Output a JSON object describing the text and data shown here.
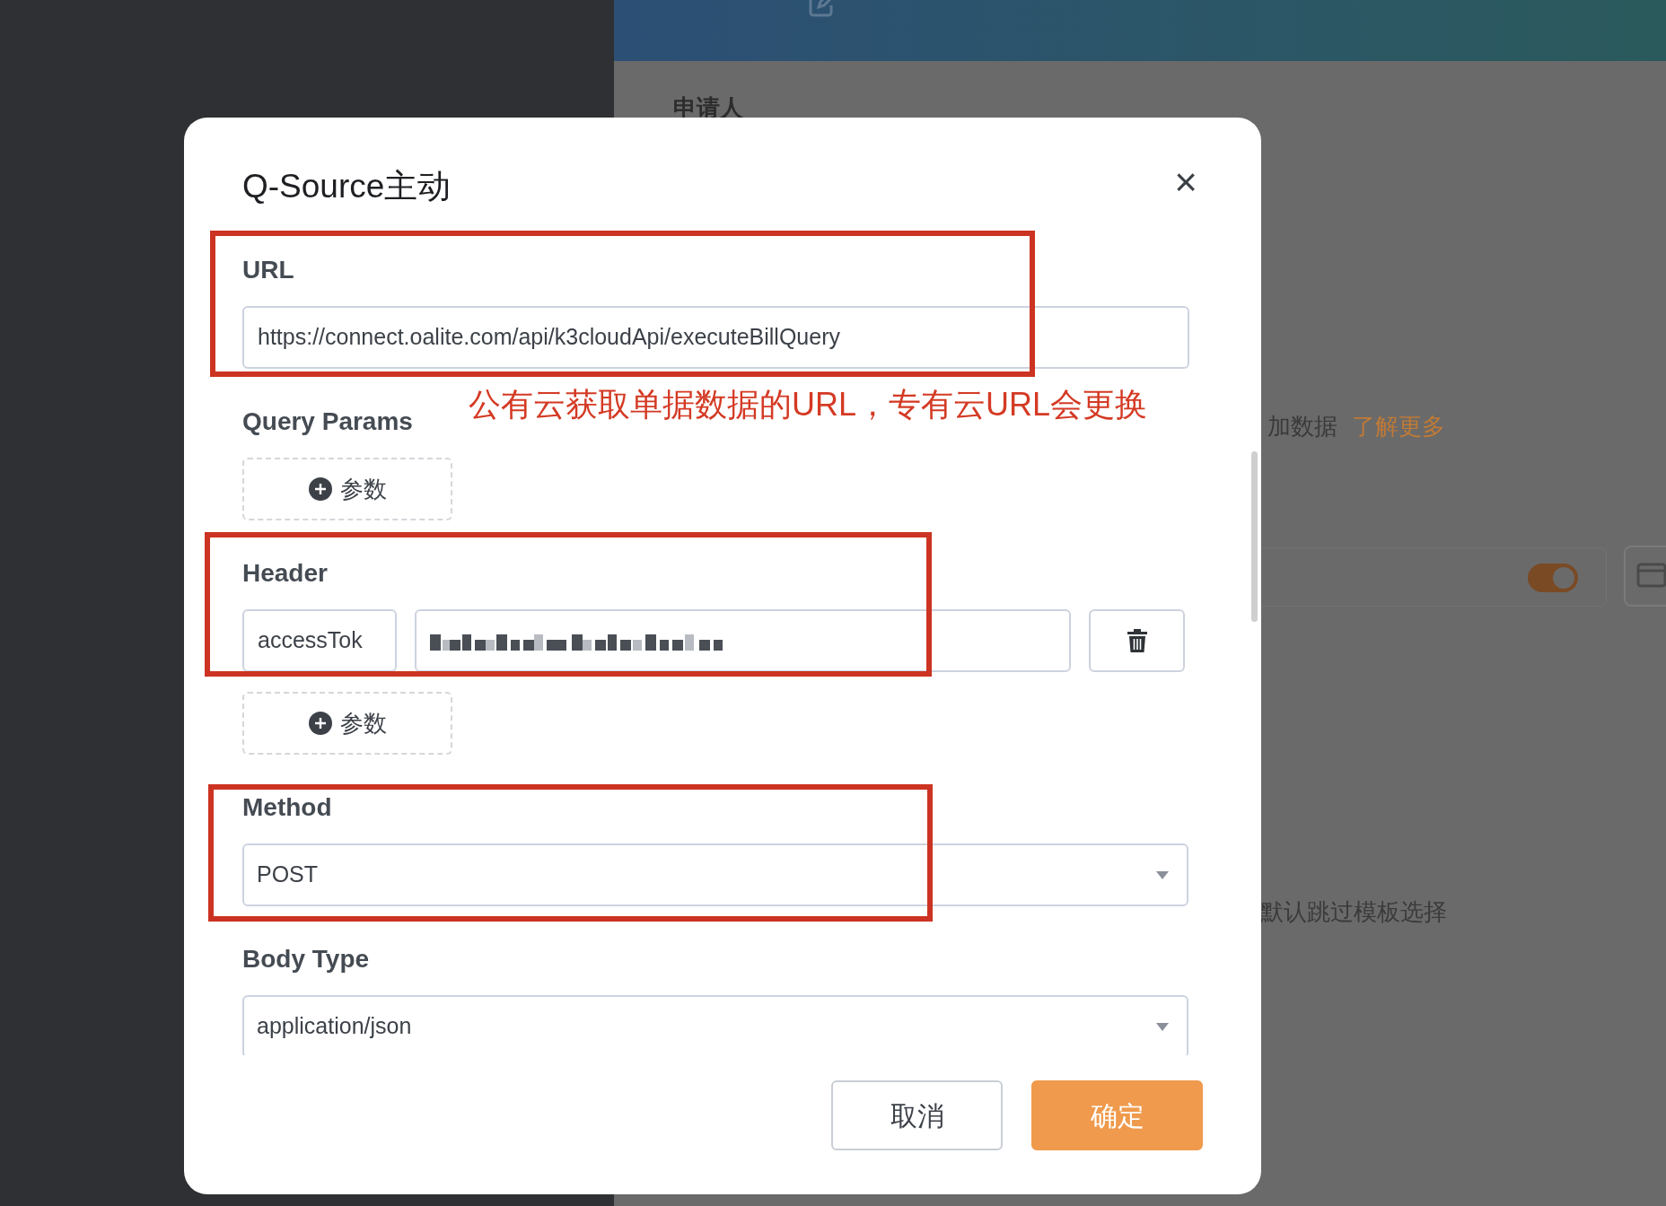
{
  "background": {
    "field_label": "申请人",
    "hint_text": "加数据",
    "link": "了解更多",
    "toggle": {
      "on": true
    },
    "template_text": "默认跳过模板选择"
  },
  "dialog": {
    "title": "Q-Source主动",
    "close": "×",
    "sections": [
      {
        "kind": "input",
        "label": "URL",
        "value": "https://connect.oalite.com/api/k3cloudApi/executeBillQuery",
        "highlighted": true,
        "note": "公有云获取单据数据的URL，专有云URL会更换"
      },
      {
        "kind": "params",
        "label": "Query Params",
        "add_label": "参数",
        "highlighted": false
      },
      {
        "kind": "params",
        "label": "Header",
        "rows": [
          {
            "key": "accessTok"
          }
        ],
        "add_label": "参数",
        "highlighted": true
      },
      {
        "kind": "select",
        "label": "Method",
        "value": "POST",
        "highlighted": true
      },
      {
        "kind": "select",
        "label": "Body Type",
        "value": "application/json",
        "highlighted": false
      }
    ],
    "buttons": [
      {
        "label": "取消",
        "kind": "secondary"
      },
      {
        "label": "确定",
        "kind": "primary"
      }
    ]
  }
}
